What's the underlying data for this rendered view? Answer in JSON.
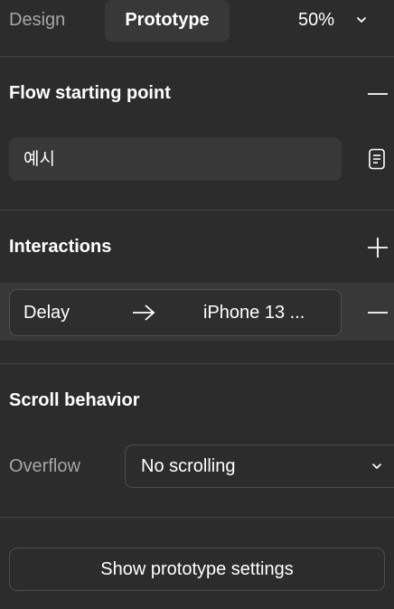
{
  "tabs": {
    "design_label": "Design",
    "prototype_label": "Prototype",
    "active": "Prototype"
  },
  "zoom": {
    "value": "50%"
  },
  "flow_starting_point": {
    "title": "Flow starting point",
    "flow_name": "예시"
  },
  "interactions": {
    "title": "Interactions",
    "items": [
      {
        "trigger": "Delay",
        "target": "iPhone 13 ..."
      }
    ]
  },
  "scroll_behavior": {
    "title": "Scroll behavior",
    "overflow_label": "Overflow",
    "overflow_value": "No scrolling"
  },
  "footer": {
    "settings_button_label": "Show prototype settings"
  },
  "colors": {
    "background": "#2c2c2c",
    "surface": "#383838",
    "border": "#4d4d4d",
    "text_primary": "#ffffff",
    "text_secondary": "#a6a6a6"
  }
}
